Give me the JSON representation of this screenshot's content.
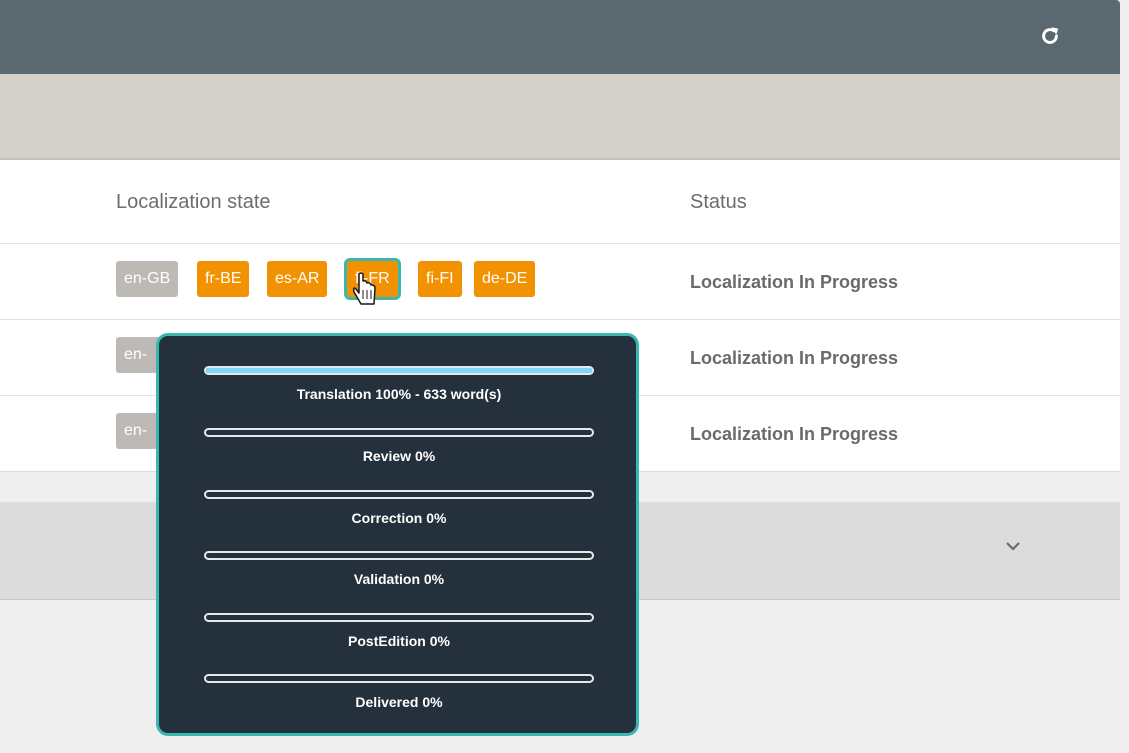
{
  "header": {
    "refresh_icon": "refresh-icon"
  },
  "table": {
    "columns": {
      "localization_state": "Localization state",
      "status": "Status"
    },
    "rows": [
      {
        "tags": [
          {
            "label": "en-GB",
            "color": "#bdbab5"
          },
          {
            "label": "fr-BE",
            "color": "#f39200"
          },
          {
            "label": "es-AR",
            "color": "#f39200"
          },
          {
            "label": "fi-FR",
            "color": "#f39200"
          },
          {
            "label": "fi-FI",
            "color": "#f39200"
          },
          {
            "label": "de-DE",
            "color": "#f39200"
          }
        ],
        "status": "Localization In Progress"
      },
      {
        "tags": [
          {
            "label": "en-",
            "color": "#bdbab5"
          }
        ],
        "status": "Localization In Progress"
      },
      {
        "tags": [
          {
            "label": "en-",
            "color": "#bdbab5"
          }
        ],
        "status": "Localization In Progress"
      }
    ]
  },
  "panel": {
    "chevron_icon": "chevron-down-icon"
  },
  "popover": {
    "stages": [
      {
        "label": "Translation 100% - 633 word(s)",
        "progress": 100
      },
      {
        "label": "Review 0%",
        "progress": 0
      },
      {
        "label": "Correction 0%",
        "progress": 0
      },
      {
        "label": "Validation 0%",
        "progress": 0
      },
      {
        "label": "PostEdition 0%",
        "progress": 0
      },
      {
        "label": "Delivered 0%",
        "progress": 0
      }
    ]
  },
  "colors": {
    "header_bg": "#5a6970",
    "tag_grey": "#bdbab5",
    "tag_orange": "#f39200",
    "accent_teal": "#39b8b1",
    "progress_fill": "#7fd6f7",
    "popover_bg": "#24303c"
  }
}
